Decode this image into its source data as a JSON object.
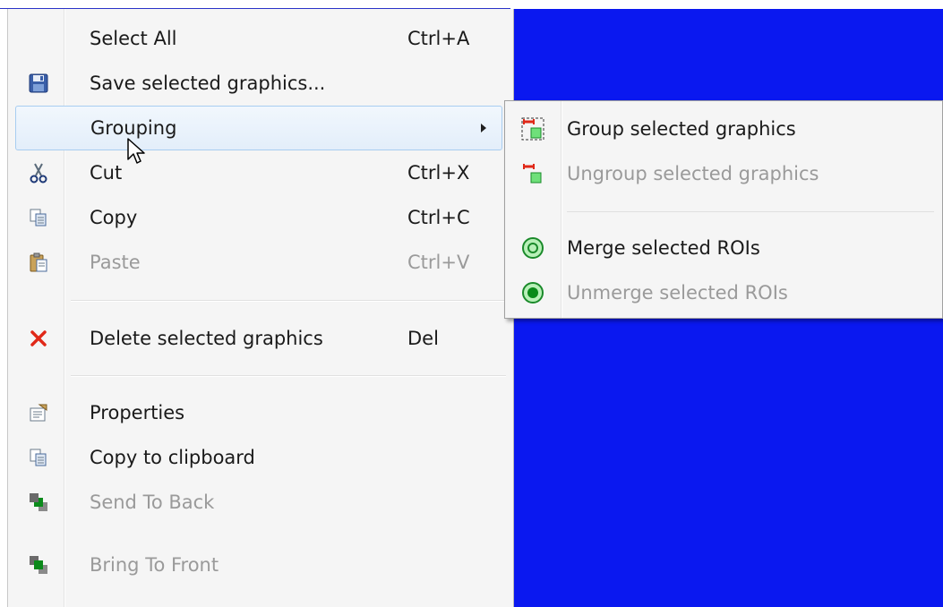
{
  "context_menu": {
    "items": [
      {
        "label": "Select All",
        "shortcut": "Ctrl+A",
        "icon": "none",
        "enabled": true
      },
      {
        "label": "Save selected graphics...",
        "shortcut": "",
        "icon": "save-icon",
        "enabled": true
      },
      {
        "label": "Grouping",
        "shortcut": "",
        "icon": "none",
        "enabled": true,
        "has_submenu": true,
        "highlighted": true
      },
      {
        "label": "Cut",
        "shortcut": "Ctrl+X",
        "icon": "scissors-icon",
        "enabled": true
      },
      {
        "label": "Copy",
        "shortcut": "Ctrl+C",
        "icon": "copy-icon",
        "enabled": true
      },
      {
        "label": "Paste",
        "shortcut": "Ctrl+V",
        "icon": "paste-icon",
        "enabled": false
      },
      {
        "label": "Delete selected graphics",
        "shortcut": "Del",
        "icon": "delete-x-icon",
        "enabled": true
      },
      {
        "label": "Properties",
        "shortcut": "",
        "icon": "properties-icon",
        "enabled": true
      },
      {
        "label": "Copy to clipboard",
        "shortcut": "",
        "icon": "copy-icon",
        "enabled": true
      },
      {
        "label": "Send To Back",
        "shortcut": "",
        "icon": "send-to-back-icon",
        "enabled": false
      },
      {
        "label": "Bring To Front",
        "shortcut": "",
        "icon": "bring-to-front-icon",
        "enabled": false
      }
    ]
  },
  "grouping_submenu": {
    "items": [
      {
        "label": "Group selected graphics",
        "icon": "group-icon",
        "enabled": true
      },
      {
        "label": "Ungroup selected graphics",
        "icon": "ungroup-icon",
        "enabled": false
      },
      {
        "label": "Merge selected ROIs",
        "icon": "merge-roi-icon",
        "enabled": true
      },
      {
        "label": "Unmerge selected ROIs",
        "icon": "unmerge-roi-icon",
        "enabled": false
      }
    ]
  },
  "colors": {
    "background_canvas": "#0a18f0",
    "menu_background": "#f5f5f5",
    "highlight_border": "#a8cdf0",
    "disabled_text": "#9a9a9a"
  }
}
